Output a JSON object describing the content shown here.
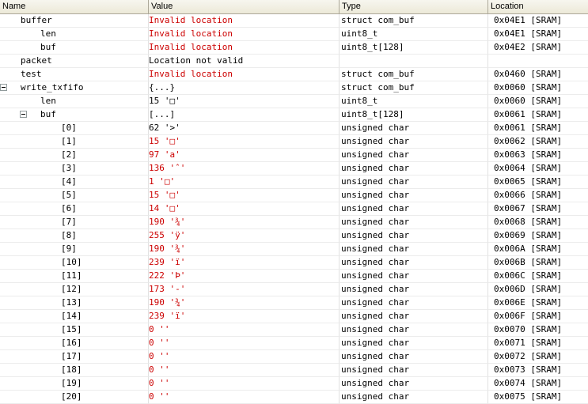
{
  "columns": {
    "name": "Name",
    "value": "Value",
    "type": "Type",
    "location": "Location"
  },
  "rows": [
    {
      "name": "buffer",
      "value": "Invalid location",
      "type": "struct com_buf",
      "location": "0x04E1 [SRAM]",
      "indent": 1,
      "red": true
    },
    {
      "name": "len",
      "value": "Invalid location",
      "type": "uint8_t",
      "location": "0x04E1 [SRAM]",
      "indent": 2,
      "red": true
    },
    {
      "name": "buf",
      "value": "Invalid location",
      "type": "uint8_t[128]",
      "location": "0x04E2 [SRAM]",
      "indent": 2,
      "red": true
    },
    {
      "name": "packet",
      "value": "Location not valid",
      "type": "",
      "location": "",
      "indent": 1,
      "red": false
    },
    {
      "name": "test",
      "value": "Invalid location",
      "type": "struct com_buf",
      "location": "0x0460 [SRAM]",
      "indent": 1,
      "red": true
    },
    {
      "name": "write_txfifo",
      "value": "{...}",
      "type": "struct com_buf",
      "location": "0x0060 [SRAM]",
      "indent": 1,
      "red": false,
      "expander": "root"
    },
    {
      "name": "len",
      "value": "15 '□'",
      "type": "uint8_t",
      "location": "0x0060 [SRAM]",
      "indent": 2,
      "red": false
    },
    {
      "name": "buf",
      "value": "[...]",
      "type": "uint8_t[128]",
      "location": "0x0061 [SRAM]",
      "indent": 2,
      "red": false,
      "expander": "nested"
    },
    {
      "name": "[0]",
      "value": "62 '>'",
      "type": "unsigned char",
      "location": "0x0061 [SRAM]",
      "indent": 3,
      "red": false
    },
    {
      "name": "[1]",
      "value": "15 '□'",
      "type": "unsigned char",
      "location": "0x0062 [SRAM]",
      "indent": 3,
      "red": true
    },
    {
      "name": "[2]",
      "value": "97 'a'",
      "type": "unsigned char",
      "location": "0x0063 [SRAM]",
      "indent": 3,
      "red": true
    },
    {
      "name": "[3]",
      "value": "136 'ˆ'",
      "type": "unsigned char",
      "location": "0x0064 [SRAM]",
      "indent": 3,
      "red": true
    },
    {
      "name": "[4]",
      "value": "1 '□'",
      "type": "unsigned char",
      "location": "0x0065 [SRAM]",
      "indent": 3,
      "red": true
    },
    {
      "name": "[5]",
      "value": "15 '□'",
      "type": "unsigned char",
      "location": "0x0066 [SRAM]",
      "indent": 3,
      "red": true
    },
    {
      "name": "[6]",
      "value": "14 '□'",
      "type": "unsigned char",
      "location": "0x0067 [SRAM]",
      "indent": 3,
      "red": true
    },
    {
      "name": "[7]",
      "value": "190 '¾'",
      "type": "unsigned char",
      "location": "0x0068 [SRAM]",
      "indent": 3,
      "red": true
    },
    {
      "name": "[8]",
      "value": "255 'ÿ'",
      "type": "unsigned char",
      "location": "0x0069 [SRAM]",
      "indent": 3,
      "red": true
    },
    {
      "name": "[9]",
      "value": "190 '¾'",
      "type": "unsigned char",
      "location": "0x006A [SRAM]",
      "indent": 3,
      "red": true
    },
    {
      "name": "[10]",
      "value": "239 'ï'",
      "type": "unsigned char",
      "location": "0x006B [SRAM]",
      "indent": 3,
      "red": true
    },
    {
      "name": "[11]",
      "value": "222 'Þ'",
      "type": "unsigned char",
      "location": "0x006C [SRAM]",
      "indent": 3,
      "red": true
    },
    {
      "name": "[12]",
      "value": "173 '-'",
      "type": "unsigned char",
      "location": "0x006D [SRAM]",
      "indent": 3,
      "red": true
    },
    {
      "name": "[13]",
      "value": "190 '¾'",
      "type": "unsigned char",
      "location": "0x006E [SRAM]",
      "indent": 3,
      "red": true
    },
    {
      "name": "[14]",
      "value": "239 'ï'",
      "type": "unsigned char",
      "location": "0x006F [SRAM]",
      "indent": 3,
      "red": true
    },
    {
      "name": "[15]",
      "value": "0 ''",
      "type": "unsigned char",
      "location": "0x0070 [SRAM]",
      "indent": 3,
      "red": true
    },
    {
      "name": "[16]",
      "value": "0 ''",
      "type": "unsigned char",
      "location": "0x0071 [SRAM]",
      "indent": 3,
      "red": true
    },
    {
      "name": "[17]",
      "value": "0 ''",
      "type": "unsigned char",
      "location": "0x0072 [SRAM]",
      "indent": 3,
      "red": true
    },
    {
      "name": "[18]",
      "value": "0 ''",
      "type": "unsigned char",
      "location": "0x0073 [SRAM]",
      "indent": 3,
      "red": true
    },
    {
      "name": "[19]",
      "value": "0 ''",
      "type": "unsigned char",
      "location": "0x0074 [SRAM]",
      "indent": 3,
      "red": true
    },
    {
      "name": "[20]",
      "value": "0 ''",
      "type": "unsigned char",
      "location": "0x0075 [SRAM]",
      "indent": 3,
      "red": true
    }
  ]
}
